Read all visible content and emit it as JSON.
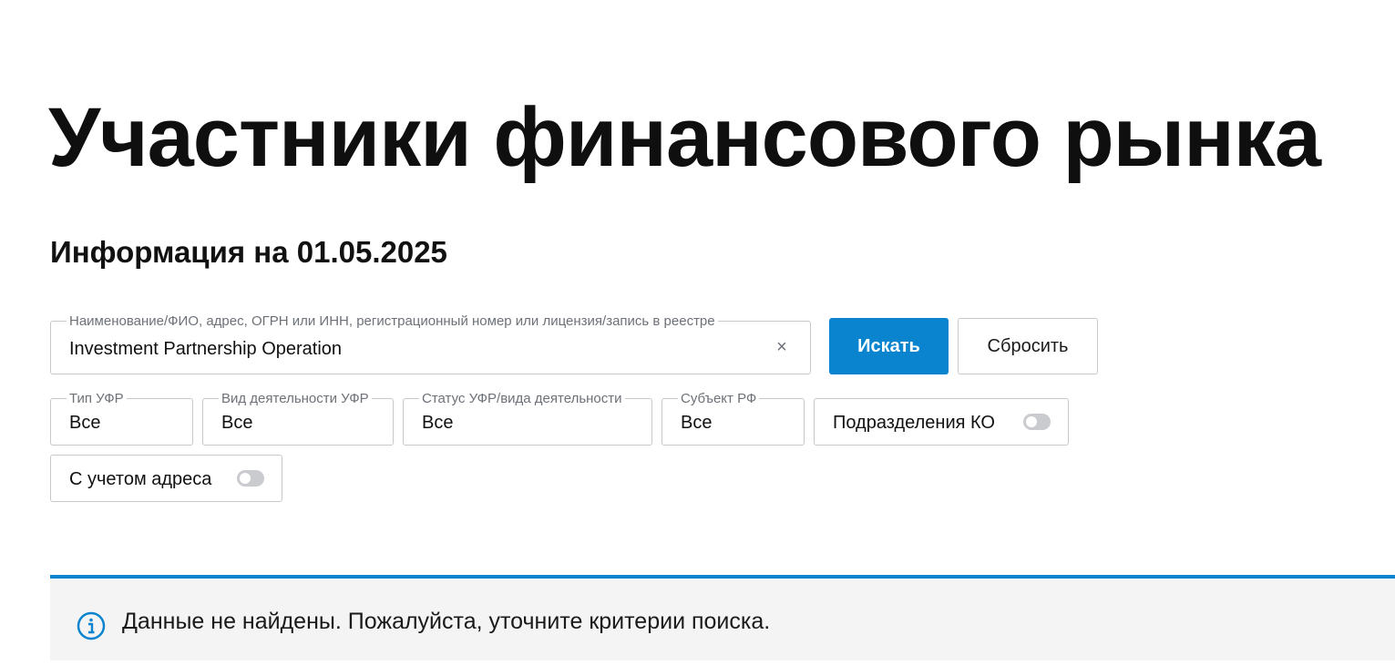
{
  "page": {
    "title": "Участники финансового рынка",
    "info_date": "Информация на 01.05.2025"
  },
  "search": {
    "legend": "Наименование/ФИО, адрес, ОГРН или ИНН, регистрационный номер или лицензия/запись в реестре",
    "value": "Investment Partnership Operation",
    "clear_icon": "×"
  },
  "buttons": {
    "search_label": "Искать",
    "reset_label": "Сбросить"
  },
  "filters": {
    "type": {
      "legend": "Тип УФР",
      "value": "Все"
    },
    "activity": {
      "legend": "Вид деятельности УФР",
      "value": "Все"
    },
    "status": {
      "legend": "Статус УФР/вида деятельности",
      "value": "Все"
    },
    "region": {
      "legend": "Субъект РФ",
      "value": "Все"
    }
  },
  "toggles": {
    "branches": {
      "label": "Подразделения КО",
      "on": false
    },
    "address": {
      "label": "С учетом адреса",
      "on": false
    }
  },
  "notice": {
    "icon": "info-icon",
    "text": "Данные не найдены. Пожалуйста, уточните критерии поиска."
  },
  "colors": {
    "accent": "#0a84cf",
    "notice_bg": "#f4f4f4",
    "border": "#c6c8cc"
  }
}
